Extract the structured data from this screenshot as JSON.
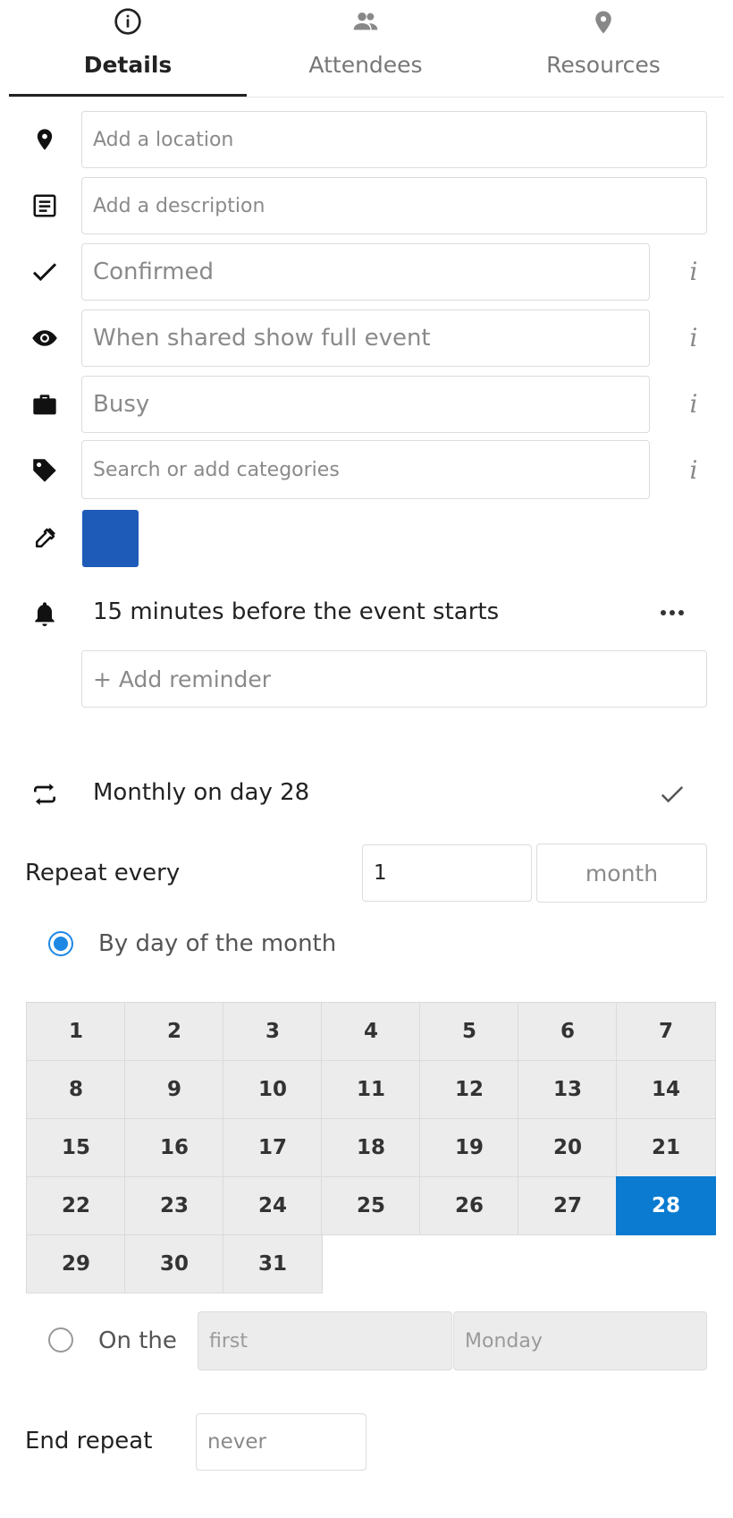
{
  "tabs": [
    {
      "label": "Details",
      "icon": "info-icon"
    },
    {
      "label": "Attendees",
      "icon": "people-icon"
    },
    {
      "label": "Resources",
      "icon": "map-marker-icon"
    }
  ],
  "location": {
    "placeholder": "Add a location"
  },
  "description": {
    "placeholder": "Add a description"
  },
  "status": {
    "value": "Confirmed"
  },
  "visibility": {
    "value": "When shared show full event"
  },
  "availability": {
    "value": "Busy"
  },
  "categories": {
    "placeholder": "Search or add categories"
  },
  "color": {
    "value": "#1e5bb8"
  },
  "reminder": {
    "text": "15 minutes before the event starts",
    "add_label": "+ Add reminder"
  },
  "repeat": {
    "summary": "Monthly on day 28",
    "repeat_every_label": "Repeat every",
    "interval": "1",
    "unit": "month",
    "by_day_label": "By day of the month",
    "days": [
      "1",
      "2",
      "3",
      "4",
      "5",
      "6",
      "7",
      "8",
      "9",
      "10",
      "11",
      "12",
      "13",
      "14",
      "15",
      "16",
      "17",
      "18",
      "19",
      "20",
      "21",
      "22",
      "23",
      "24",
      "25",
      "26",
      "27",
      "28",
      "29",
      "30",
      "31"
    ],
    "selected_day": "28",
    "on_the_label": "On the",
    "ordinal": "first",
    "weekday": "Monday",
    "end_label": "End repeat",
    "end_value": "never"
  }
}
